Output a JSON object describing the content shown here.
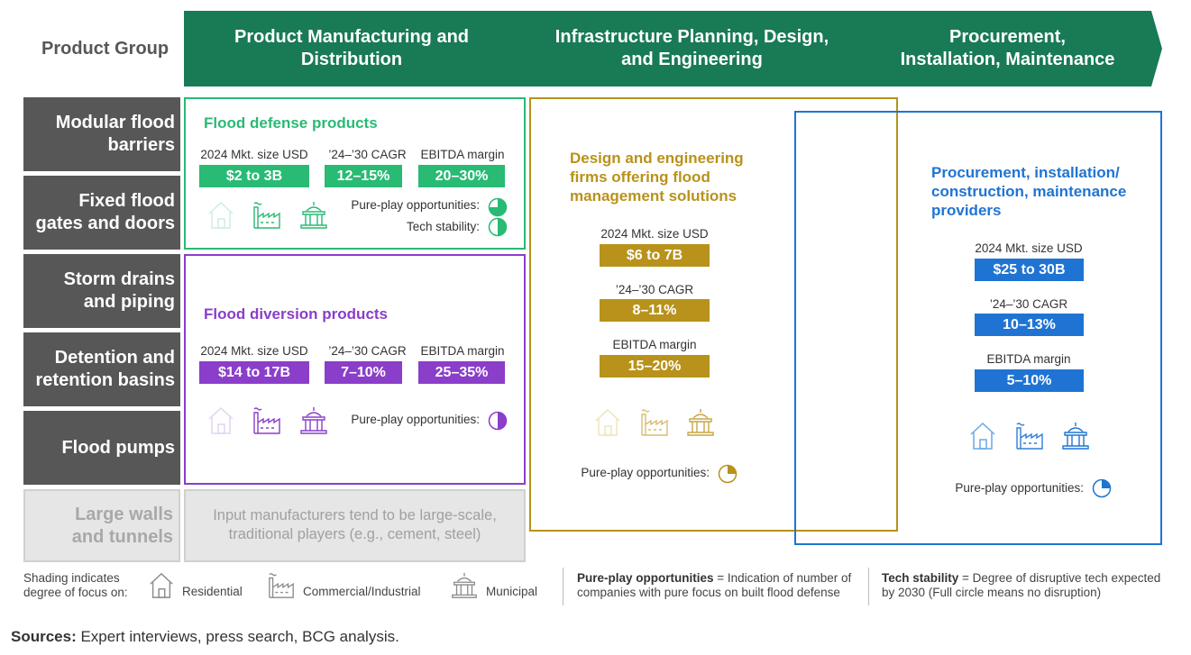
{
  "header": {
    "product_group_label": "Product Group",
    "chevrons": [
      {
        "line1": "Product Manufacturing and",
        "line2": "Distribution"
      },
      {
        "line1": "Infrastructure Planning, Design,",
        "line2": "and Engineering"
      },
      {
        "line1": "Procurement,",
        "line2": "Installation, Maintenance"
      }
    ]
  },
  "rows": [
    {
      "line1": "Modular flood",
      "line2": "barriers"
    },
    {
      "line1": "Fixed flood",
      "line2": "gates and doors"
    },
    {
      "line1": "Storm drains",
      "line2": "and piping"
    },
    {
      "line1": "Detention and",
      "line2": "retention basins"
    },
    {
      "line1": "Flood pumps",
      "line2": ""
    },
    {
      "line1": "Large walls",
      "line2": "and tunnels"
    }
  ],
  "defense": {
    "title": "Flood defense products",
    "metrics": [
      {
        "label": "2024 Mkt. size USD",
        "value": "$2 to 3B"
      },
      {
        "label": "’24–’30 CAGR",
        "value": "12–15%"
      },
      {
        "label": "EBITDA margin",
        "value": "20–30%"
      }
    ],
    "pure_play_label": "Pure-play opportunities:",
    "pure_play_level": 0.75,
    "tech_label": "Tech stability:",
    "tech_level": 0.5
  },
  "diversion": {
    "title": "Flood diversion products",
    "metrics": [
      {
        "label": "2024 Mkt. size USD",
        "value": "$14 to 17B"
      },
      {
        "label": "’24–’30 CAGR",
        "value": "7–10%"
      },
      {
        "label": "EBITDA margin",
        "value": "25–35%"
      }
    ],
    "pure_play_label": "Pure-play opportunities:",
    "pure_play_level": 0.5
  },
  "walls_note": {
    "line1": "Input manufacturers tend to be large-scale,",
    "line2": "traditional players (e.g., cement, steel)"
  },
  "design": {
    "title_lines": [
      "Design and engineering",
      "firms offering flood",
      "management solutions"
    ],
    "metrics": [
      {
        "label": "2024 Mkt. size USD",
        "value": "$6 to 7B"
      },
      {
        "label": "’24–’30 CAGR",
        "value": "8–11%"
      },
      {
        "label": "EBITDA margin",
        "value": "15–20%"
      }
    ],
    "pure_play_label": "Pure-play opportunities:",
    "pure_play_level": 0.25
  },
  "procurement": {
    "title_lines": [
      "Procurement, installation/",
      "construction, maintenance",
      "providers"
    ],
    "metrics": [
      {
        "label": "2024 Mkt. size USD",
        "value": "$25 to 30B"
      },
      {
        "label": "’24–’30 CAGR",
        "value": "10–13%"
      },
      {
        "label": "EBITDA margin",
        "value": "5–10%"
      }
    ],
    "pure_play_label": "Pure-play opportunities:",
    "pure_play_level": 0.25
  },
  "legend": {
    "shading_line1": "Shading indicates",
    "shading_line2": "degree of focus on:",
    "residential": "Residential",
    "commercial": "Commercial/Industrial",
    "municipal": "Municipal",
    "pureplay_term": "Pure-play opportunities",
    "pureplay_def1": " = Indication of number of",
    "pureplay_def2": "companies with pure focus on built flood defense",
    "tech_term": "Tech stability",
    "tech_def1": " = Degree of disruptive tech expected",
    "tech_def2": "by 2030 (Full circle means no disruption)"
  },
  "sources": {
    "label": "Sources:",
    "text": " Expert interviews, press search, BCG analysis."
  },
  "colors": {
    "header_green": "#197a56",
    "defense_green": "#29ba74",
    "diversion_purple": "#8a3ec9",
    "design_gold": "#b8921a",
    "procurement_blue": "#1f74d3",
    "row_gray": "#575757"
  }
}
